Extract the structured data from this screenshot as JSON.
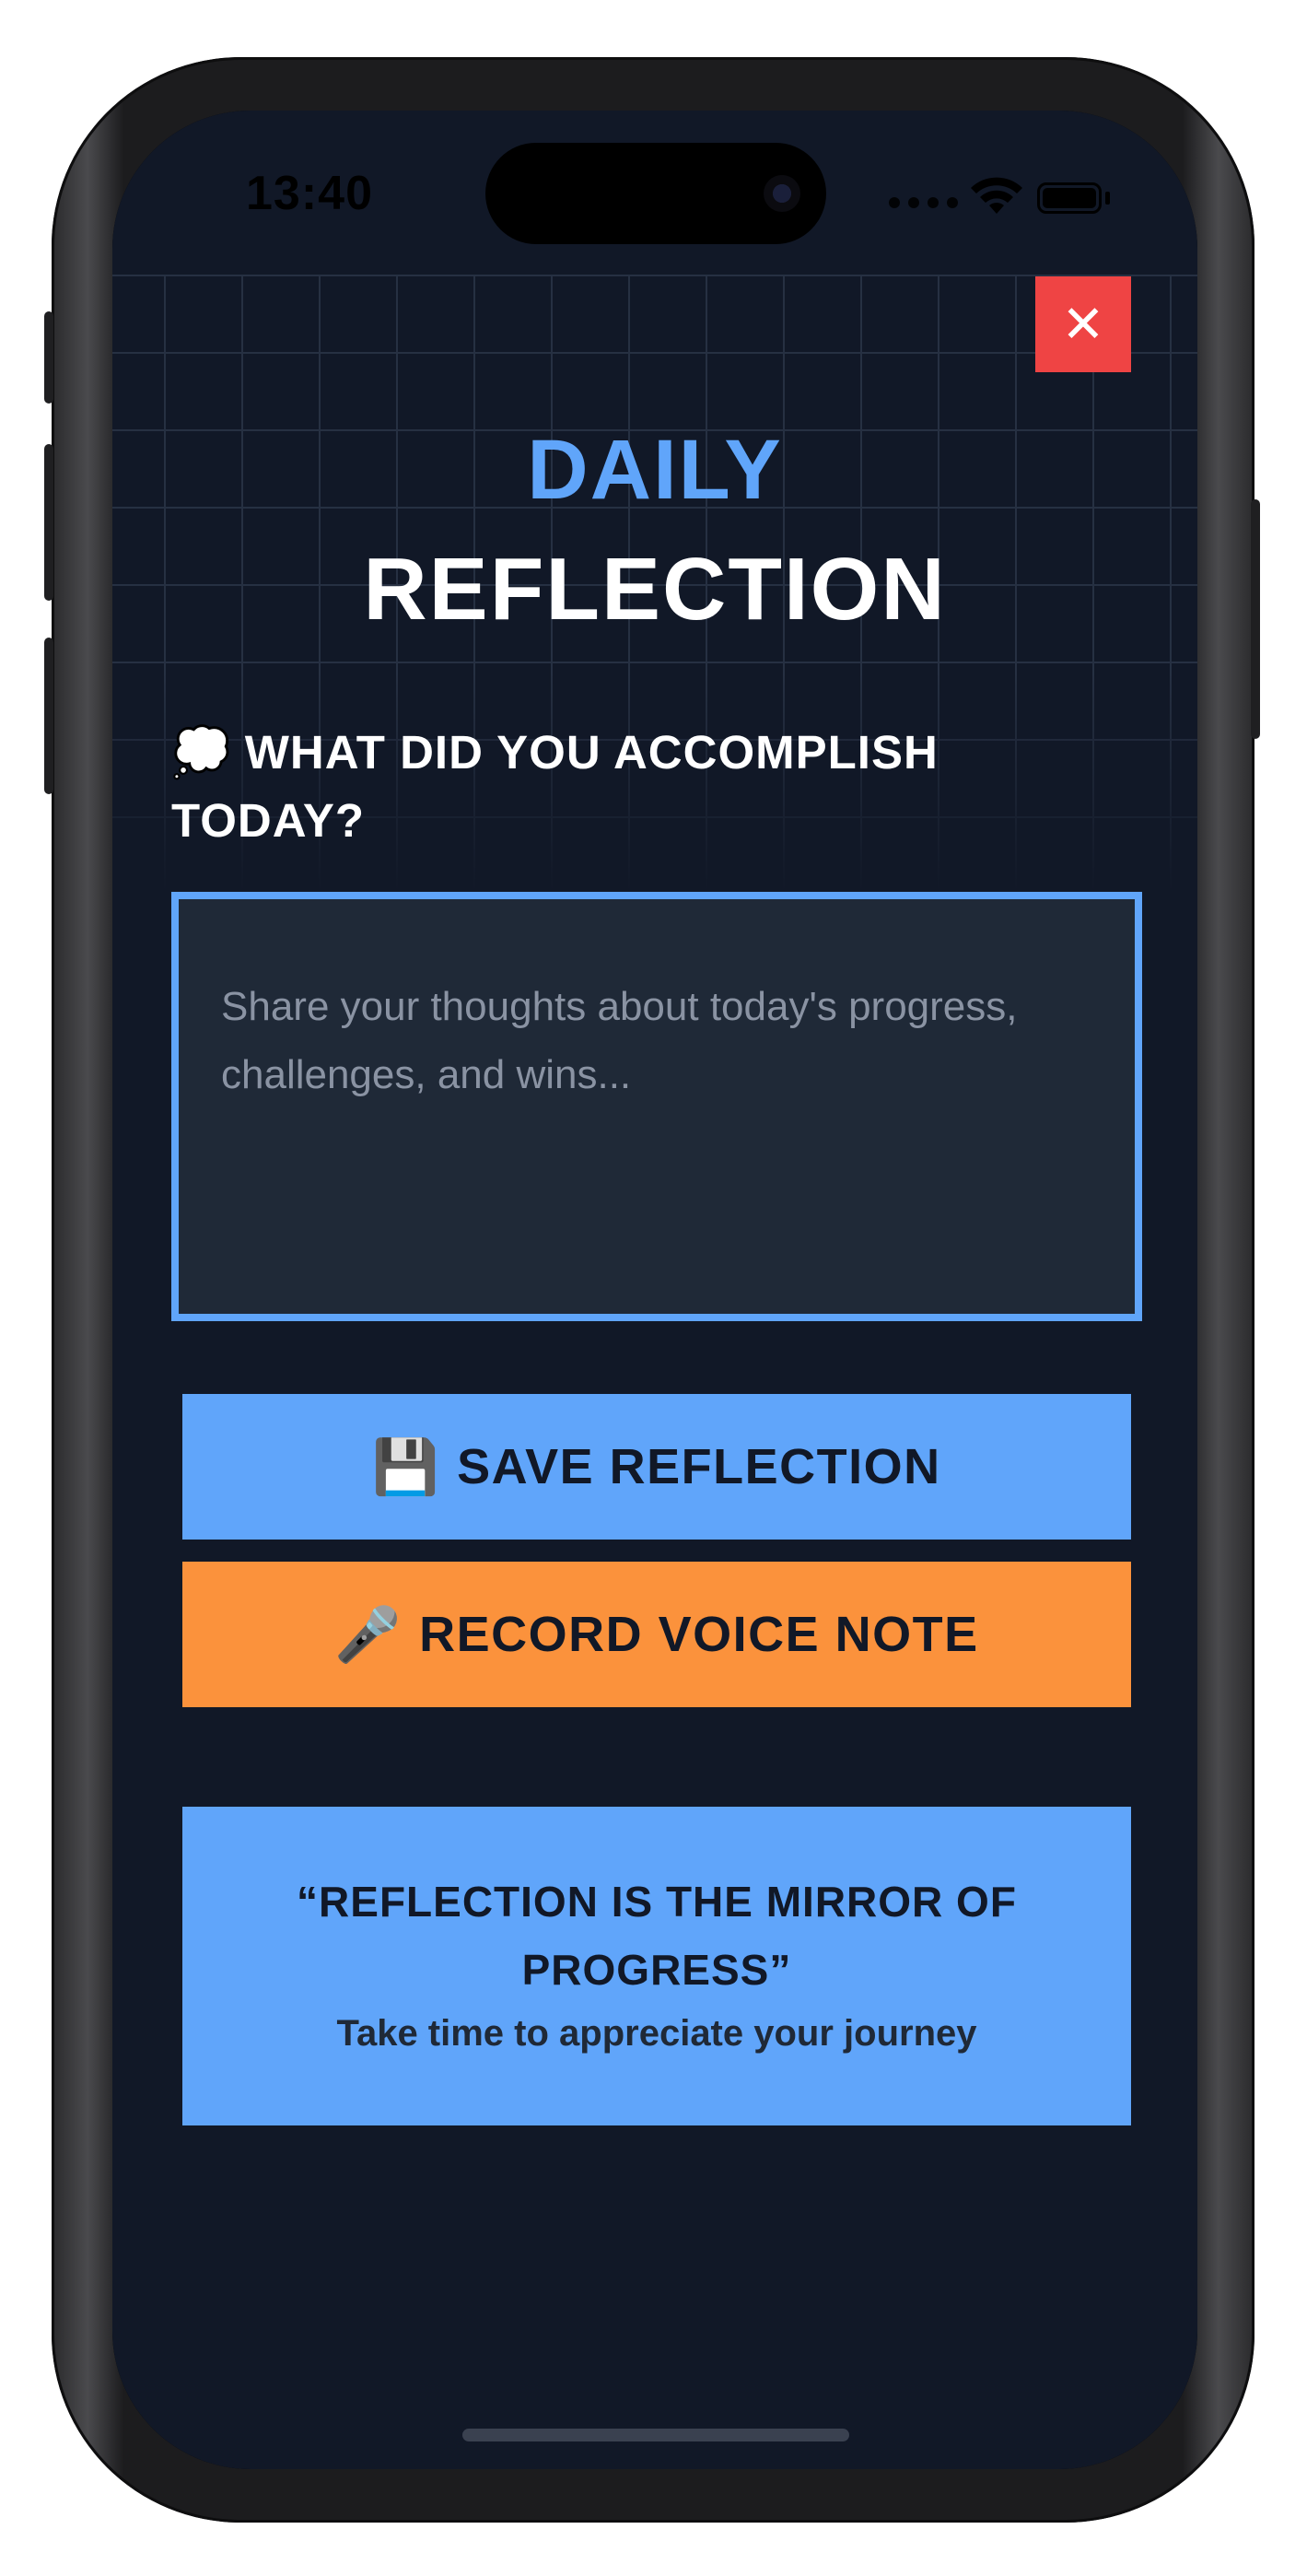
{
  "status_bar": {
    "time": "13:40"
  },
  "header": {
    "close_label": "✕",
    "title_line1": "DAILY",
    "title_line2": "REFLECTION"
  },
  "prompt": {
    "emoji": "💭",
    "label": "WHAT DID YOU ACCOMPLISH TODAY?"
  },
  "reflection_input": {
    "value": "",
    "placeholder": "Share your thoughts about today's progress, challenges, and wins..."
  },
  "actions": {
    "save_icon": "💾",
    "save_label": "SAVE REFLECTION",
    "voice_icon": "🎤",
    "voice_label": "RECORD VOICE NOTE"
  },
  "quote": {
    "text": "“REFLECTION IS THE MIRROR OF PROGRESS”",
    "subtitle": "Take time to appreciate your journey"
  },
  "colors": {
    "background": "#111827",
    "accent_blue": "#60a5fa",
    "accent_orange": "#fb923c",
    "close_red": "#ef4444"
  },
  "icons": {
    "close": "close-icon",
    "thought": "thought-bubble-icon",
    "save": "floppy-disk-icon",
    "voice": "microphone-icon"
  }
}
